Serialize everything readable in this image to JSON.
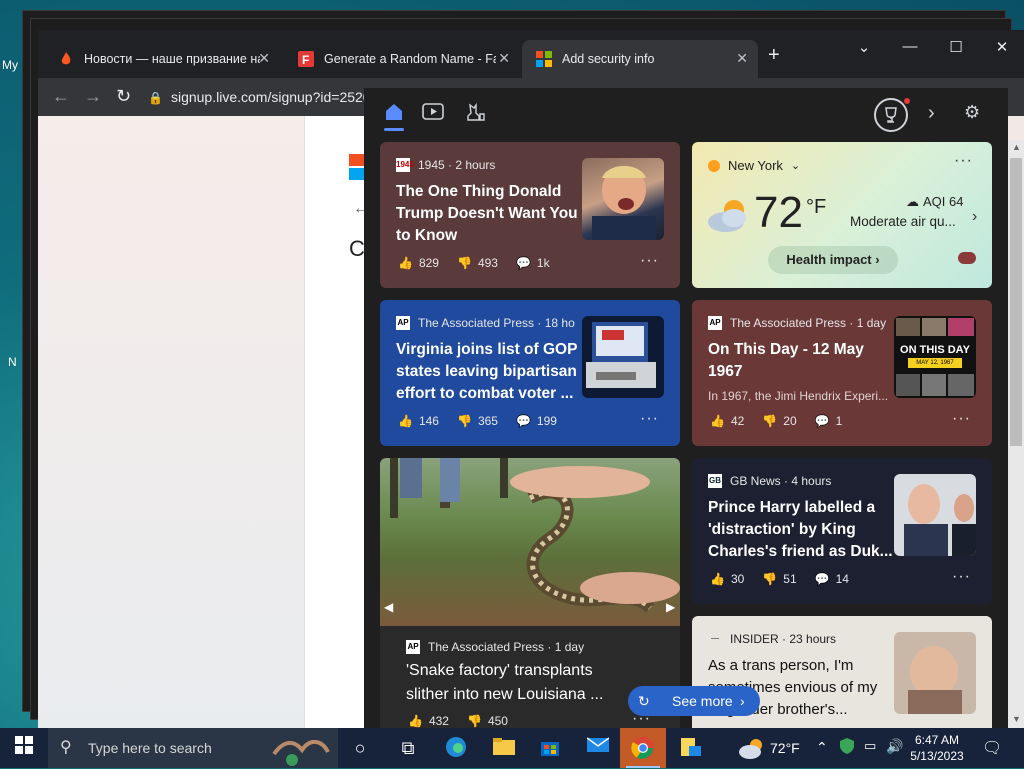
{
  "desktop": {
    "labels": [
      "My",
      "N"
    ]
  },
  "browser": {
    "tabs": [
      {
        "title": "Новости — наше призвание на",
        "favicon": "flame-icon",
        "color": "#ff5722"
      },
      {
        "title": "Generate a Random Name - Fak",
        "favicon": "fakename-icon",
        "color": "#e53935"
      },
      {
        "title": "Add security info",
        "favicon": "microsoft-icon",
        "color": "#00a4ef"
      }
    ],
    "url": "signup.live.com/signup?id=2520..."
  },
  "news": {
    "cards": [
      {
        "source": "1945",
        "time": "1945 · 2 hours",
        "headline": "The One Thing Donald Trump Doesn't Want You to Know",
        "likes": "829",
        "dislikes": "493",
        "comments": "1k",
        "color": "#5a3a3a"
      },
      {
        "source": "The Associated Press",
        "time": "The Associated Press · 18 ho",
        "headline": "Virginia joins list of GOP states leaving bipartisan effort to combat voter ...",
        "likes": "146",
        "dislikes": "365",
        "comments": "199",
        "color": "#1f4a9e"
      },
      {
        "source": "The Associated Press",
        "time": "The Associated Press · 1 day",
        "headline": "On This Day - 12 May 1967",
        "snippet": "In 1967, the Jimi Hendrix Experi...",
        "likes": "42",
        "dislikes": "20",
        "comments": "1",
        "thumb_text": "ON THIS DAY",
        "thumb_date": "MAY 12, 1967",
        "color": "#6b3838"
      },
      {
        "source": "The Associated Press",
        "time": "The Associated Press · 1 day",
        "headline": "'Snake factory' transplants slither into new Louisiana ...",
        "likes": "432",
        "dislikes": "450"
      },
      {
        "source": "GB News",
        "time": "GB News · 4 hours",
        "headline": "Prince Harry labelled a 'distraction' by King Charles's friend as Duk...",
        "likes": "30",
        "dislikes": "51",
        "comments": "14"
      },
      {
        "source": "INSIDER",
        "time": "INSIDER · 23 hours",
        "headline": "As a trans person, I'm sometimes envious of my cisgender brother's..."
      }
    ],
    "weather": {
      "location": "New York",
      "temp": "72",
      "unit": "°F",
      "aqi": "AQI 64",
      "aqi_desc": "Moderate air qu...",
      "health_btn": "Health impact"
    },
    "see_more": "See more"
  },
  "taskbar": {
    "search_placeholder": "Type here to search",
    "weather": "72°F",
    "time": "6:47 AM",
    "date": "5/13/2023"
  }
}
